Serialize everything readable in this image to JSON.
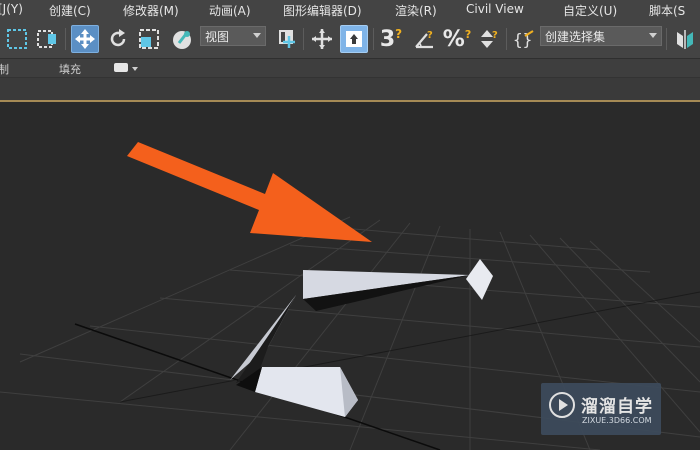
{
  "menu": {
    "items": [
      "[J(Y)",
      "创建(C)",
      "修改器(M)",
      "动画(A)",
      "图形编辑器(D)",
      "渲染(R)",
      "Civil View",
      "自定义(U)",
      "脚本(S"
    ]
  },
  "toolbar": {
    "view_dropdown": "视图",
    "selection_set_dropdown": "创建选择集",
    "snap_label": "3",
    "icons": [
      "select-region-icon",
      "window-crossing-icon",
      "select-move-icon",
      "rotate-icon",
      "scale-icon",
      "pick-object-icon",
      "use-pivot-icon",
      "select-manipulate-icon",
      "keyboard-shortcut-icon",
      "snap-toggle-icon",
      "angle-snap-icon",
      "percent-snap-icon",
      "spinner-snap-icon",
      "edit-named-selection-icon",
      "mirror-icon"
    ]
  },
  "ribbon": {
    "left_label": "制",
    "fill_label": "填充"
  },
  "watermark": {
    "title": "溜溜自学",
    "url": "ZIXUE.3D66.COM"
  },
  "colors": {
    "arrow": "#f4601c",
    "toolbar_bg": "#444444",
    "viewport_bg": "#2a2a2a",
    "active_button": "#5b8fc4",
    "model": "#dfe3ee"
  }
}
